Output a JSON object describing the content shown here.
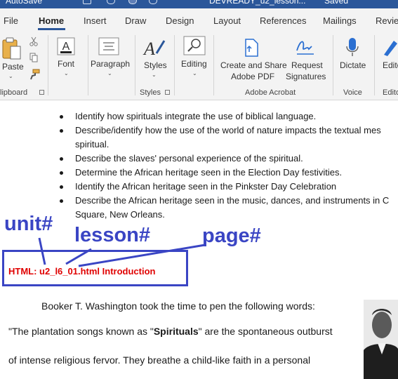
{
  "titlebar": {
    "autosave_label": "AutoSave",
    "filename": "DEVREADY_u2_lesson...",
    "saved_status": "Saved"
  },
  "tabs": [
    "File",
    "Home",
    "Insert",
    "Draw",
    "Design",
    "Layout",
    "References",
    "Mailings",
    "Revie"
  ],
  "active_tab": "Home",
  "ribbon": {
    "paste_label": "Paste",
    "clipboard_group": "lipboard",
    "font_label": "Font",
    "paragraph_label": "Paragraph",
    "styles_label": "Styles",
    "styles_group": "Styles",
    "editing_label": "Editing",
    "create_share_line1": "Create and Share",
    "create_share_line2": "Adobe PDF",
    "request_sig_line1": "Request",
    "request_sig_line2": "Signatures",
    "acrobat_group": "Adobe Acrobat",
    "dictate_label": "Dictate",
    "voice_group": "Voice",
    "editor_label": "Edito",
    "editor_group": "Edito"
  },
  "document": {
    "bullets": [
      "Identify how spirituals integrate the use of biblical language.",
      "Describe/identify how the use of the world of nature impacts the textual mes",
      "spiritual.",
      "Describe the slaves' personal experience of the spiritual.",
      "Determine the African heritage seen in the Election Day festivities.",
      "Identify the African heritage seen in the Pinkster Day Celebration",
      "Describe the African heritage seen in the music, dances, and instruments in C",
      "Square, New Orleans."
    ],
    "annotations": {
      "unit": "unit#",
      "lesson": "lesson#",
      "page": "page#"
    },
    "html_line": "HTML: u2_l6_01.html   Introduction",
    "para1": "Booker T. Washington took the time to pen the following words:",
    "para2_pre": "\"The plantation songs known as \"",
    "para2_bold": "Spirituals",
    "para2_post": "\" are the spontaneous outburst",
    "para3": "of intense religious fervor. They breathe a child-like faith in a personal"
  },
  "colors": {
    "word_blue": "#2b579a",
    "annotation_blue": "#3a45c4",
    "html_red": "#e00000"
  }
}
